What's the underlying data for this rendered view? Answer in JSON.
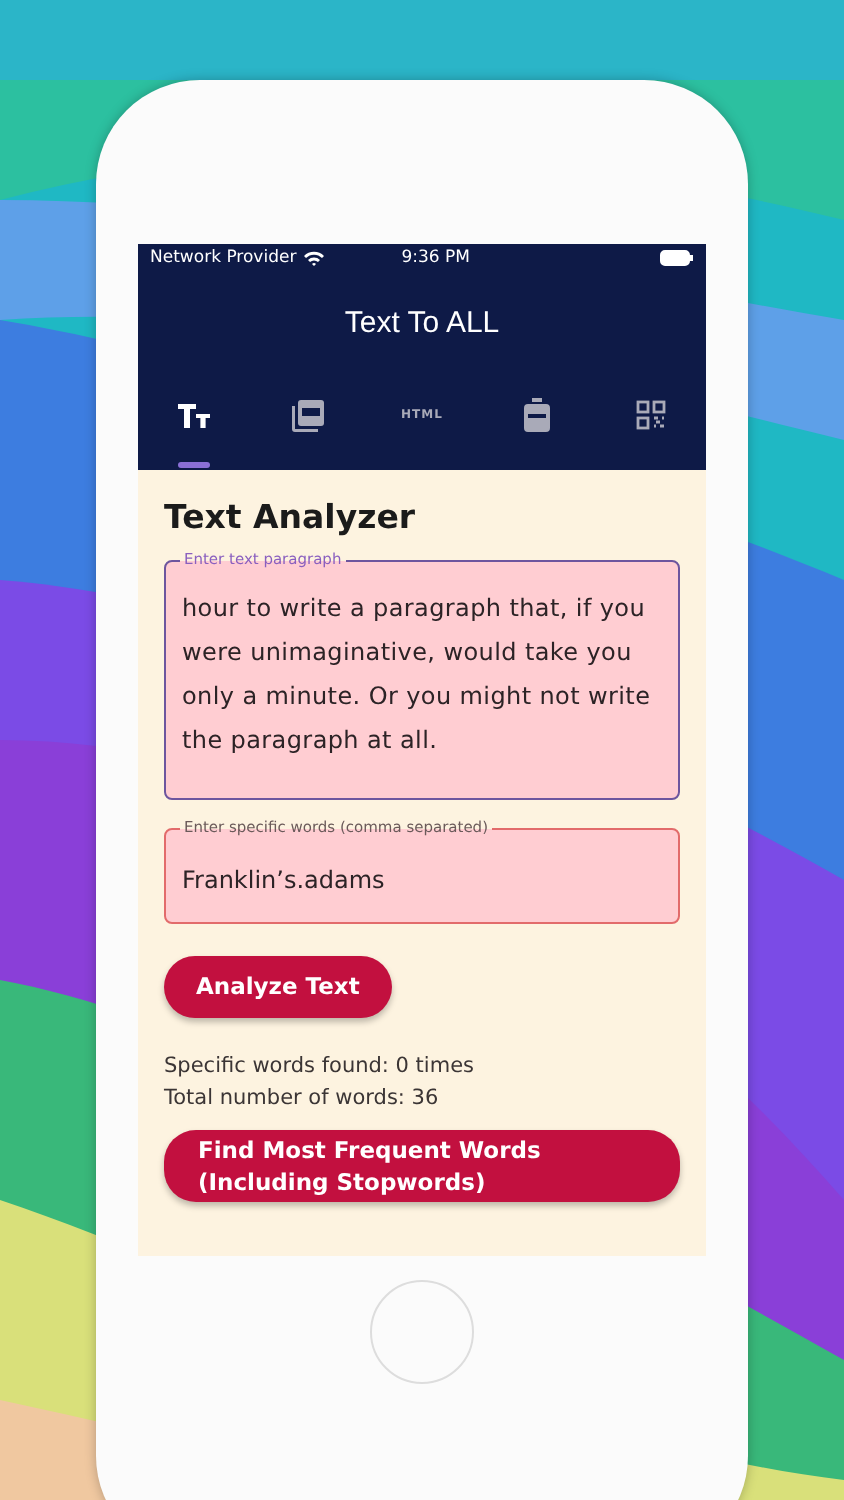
{
  "status_bar": {
    "carrier": "Network Provider",
    "time": "9:36 PM"
  },
  "app_bar": {
    "title": "Text To ALL"
  },
  "tabs": [
    {
      "kind": "text",
      "selected": true
    },
    {
      "kind": "pdf",
      "selected": false
    },
    {
      "kind": "html",
      "label": "HTML",
      "selected": false
    },
    {
      "kind": "backpack",
      "selected": false
    },
    {
      "kind": "qr",
      "selected": false
    }
  ],
  "heading": "Text Analyzer",
  "paragraph_field": {
    "label": "Enter text paragraph",
    "value": "hour to write a paragraph that, if you were unimaginative, would take you only a minute. Or you might not write the paragraph at all.",
    "focused": true
  },
  "words_field": {
    "label": "Enter specific words (comma separated)",
    "value": "Franklin’s.adams",
    "focused": false
  },
  "analyze_button": "Analyze Text",
  "results": [
    "Specific words found: 0 times",
    "Total number of words: 36"
  ],
  "frequent_button": "Find Most Frequent Words (Including Stopwords)"
}
